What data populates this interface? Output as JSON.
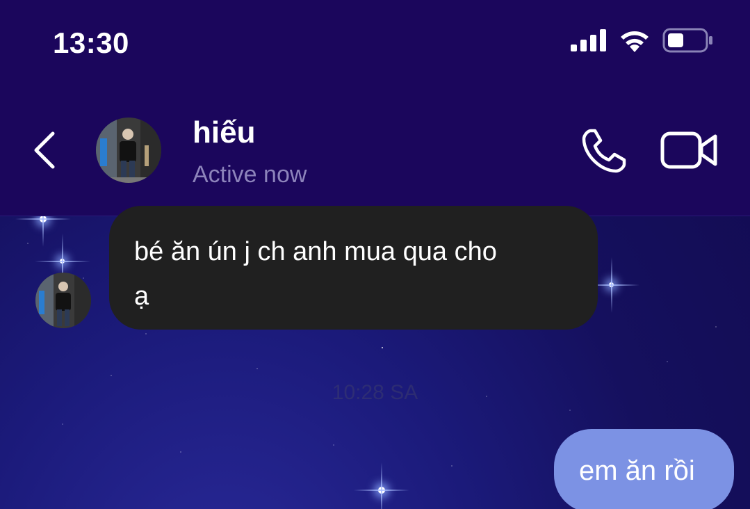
{
  "status_bar": {
    "time": "13:30",
    "icons": [
      "signal-icon",
      "wifi-icon",
      "battery-icon"
    ]
  },
  "header": {
    "contact_name": "hiếu",
    "contact_status": "Active now",
    "icons": [
      "back-chevron-icon",
      "phone-icon",
      "video-camera-icon"
    ]
  },
  "messages": [
    {
      "direction": "incoming",
      "text_line1": "bé ăn ún j ch anh mua qua cho",
      "text_line2": "ạ"
    },
    {
      "direction": "timestamp",
      "text": "10:28 SA"
    },
    {
      "direction": "outgoing",
      "text": "em ăn rồi"
    }
  ],
  "colors": {
    "header_bg": "#1b065c",
    "incoming_bubble": "#202020",
    "outgoing_bubble": "#7c92e4",
    "status_text": "#8d84bb"
  }
}
